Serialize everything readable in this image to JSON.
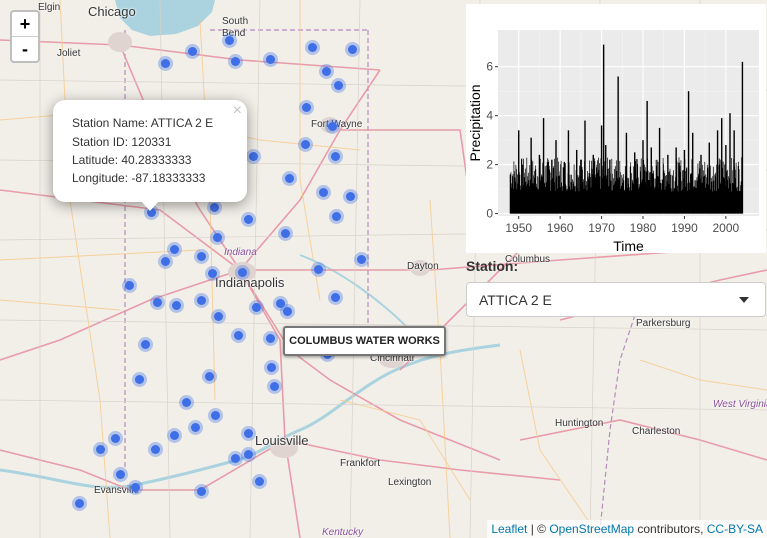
{
  "map": {
    "zoom_in": "+",
    "zoom_out": "-",
    "cities": {
      "chicago": "Chicago",
      "elgin": "Elgin",
      "joliet": "Joliet",
      "south_bend": "South Bend",
      "fort_wayne": "Fort Wayne",
      "indiana": "Indiana",
      "indianapolis": "Indianapolis",
      "dayton": "Dayton",
      "cincinnati": "Cincinnati",
      "columbus": "Columbus",
      "louisville": "Louisville",
      "frankfort": "Frankfort",
      "lexington": "Lexington",
      "evansville": "Evansville",
      "kentucky": "Kentucky",
      "huntington": "Huntington",
      "charleston": "Charleston",
      "west_virginia": "West Virginia",
      "parkersburg": "Parkersburg"
    },
    "hover_label": "COLUMBUS WATER WORKS",
    "marker_color": "#3f6fe6"
  },
  "popup": {
    "close": "×",
    "station_name": "Station Name: ATTICA 2 E",
    "station_id": "Station ID: 120331",
    "latitude": "Latitude: 40.28333333",
    "longitude": "Longitude: -87.18333333"
  },
  "chart_data": {
    "type": "line",
    "title": "",
    "xlabel": "Time",
    "ylabel": "Precipitation",
    "xlim": [
      1945,
      2008
    ],
    "ylim": [
      -0.1,
      7.5
    ],
    "x_ticks": [
      1950,
      1960,
      1970,
      1980,
      1990,
      2000
    ],
    "y_ticks": [
      0,
      2,
      4,
      6
    ],
    "grid": true,
    "series": [
      {
        "x": [
          1948,
          1950,
          1951,
          1953,
          1955,
          1956,
          1958,
          1959,
          1961,
          1962,
          1964,
          1965,
          1966,
          1968,
          1970,
          1970.5,
          1971,
          1972,
          1974,
          1976,
          1978,
          1980,
          1981,
          1982,
          1984,
          1986,
          1988,
          1990,
          1991,
          1992,
          1994,
          1996,
          1998,
          1999,
          2000,
          2001,
          2002,
          2004
        ],
        "y": [
          1.6,
          3.4,
          2.0,
          3.1,
          2.4,
          3.9,
          2.2,
          3.0,
          2.1,
          3.4,
          2.6,
          2.2,
          3.8,
          2.4,
          3.6,
          6.9,
          2.8,
          2.2,
          5.6,
          3.3,
          2.5,
          3.0,
          4.6,
          2.7,
          3.5,
          2.4,
          2.7,
          2.6,
          5.0,
          3.3,
          2.4,
          2.9,
          3.4,
          3.9,
          2.8,
          4.1,
          3.4,
          6.2
        ]
      }
    ],
    "axis_text_color": "#4d4d4d"
  },
  "controls": {
    "station_label": "Station:",
    "station_value": "ATTICA 2 E"
  },
  "attribution": {
    "leaflet": "Leaflet",
    "sep": " | © ",
    "osm": "OpenStreetMap",
    "contrib": " contributors, ",
    "license": "CC-BY-SA"
  }
}
